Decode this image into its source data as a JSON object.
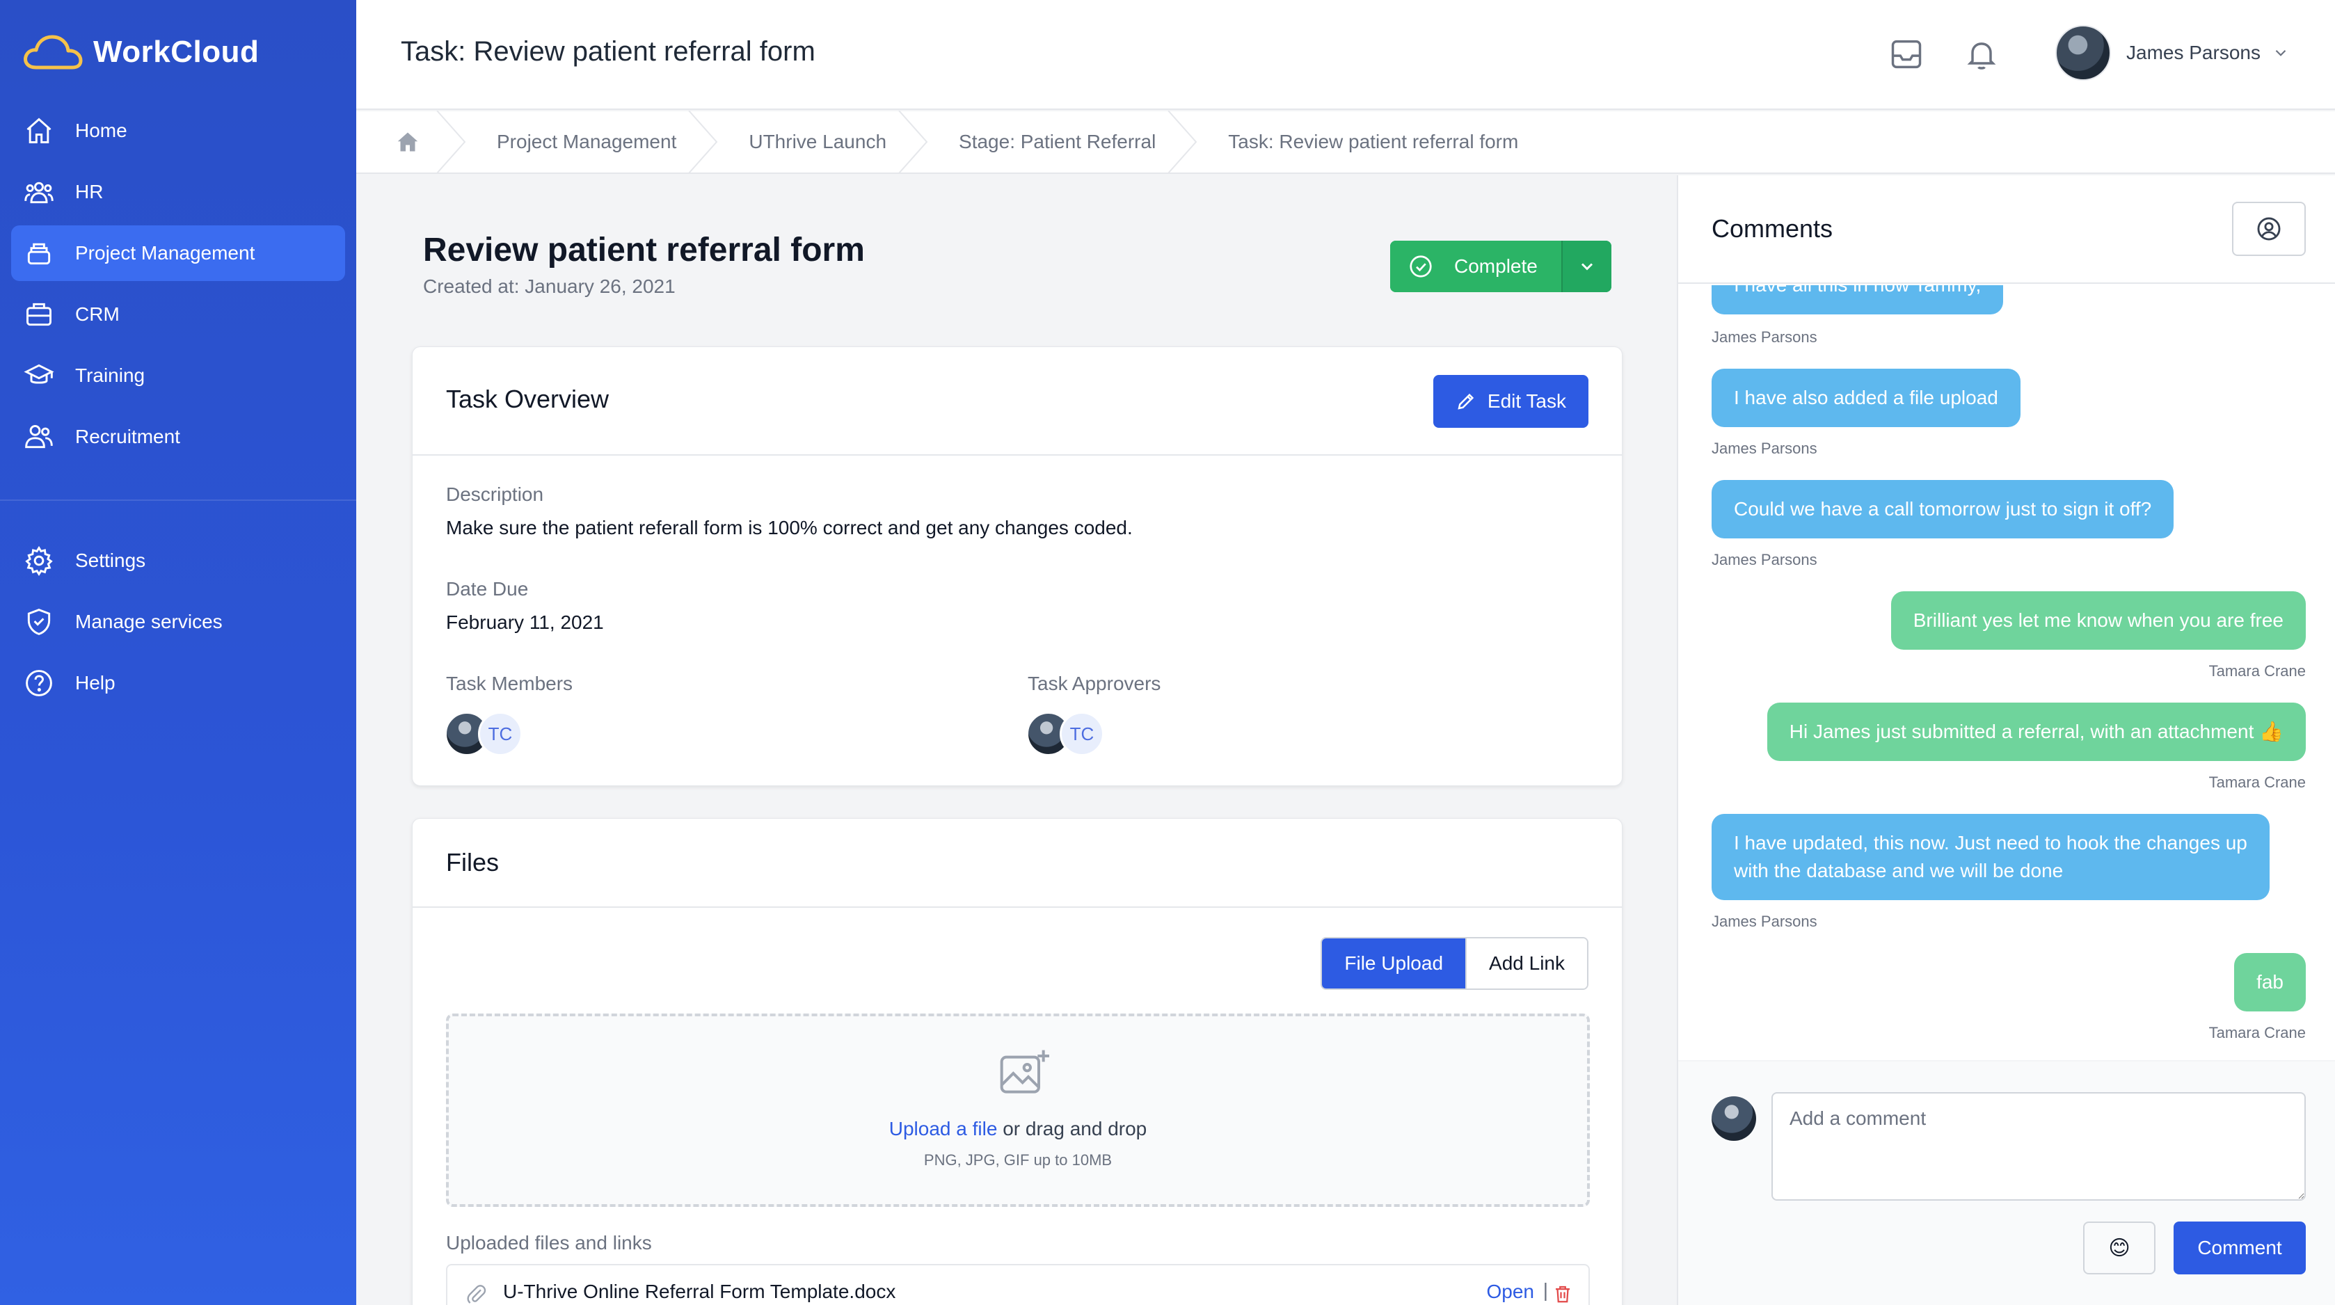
{
  "app": {
    "name": "WorkCloud"
  },
  "sidebar": {
    "items": [
      {
        "label": "Home",
        "icon": "home-icon"
      },
      {
        "label": "HR",
        "icon": "users-icon"
      },
      {
        "label": "Project Management",
        "icon": "stack-icon",
        "active": true
      },
      {
        "label": "CRM",
        "icon": "briefcase-icon"
      },
      {
        "label": "Training",
        "icon": "graduation-cap-icon"
      },
      {
        "label": "Recruitment",
        "icon": "user-group-icon"
      }
    ],
    "secondary": [
      {
        "label": "Settings",
        "icon": "gear-icon"
      },
      {
        "label": "Manage services",
        "icon": "shield-check-icon"
      },
      {
        "label": "Help",
        "icon": "question-circle-icon"
      }
    ]
  },
  "header": {
    "title": "Task: Review patient referral form",
    "user_name": "James Parsons"
  },
  "breadcrumbs": [
    "Project Management",
    "UThrive Launch",
    "Stage: Patient Referral",
    "Task: Review patient referral form"
  ],
  "task": {
    "title": "Review patient referral form",
    "created": "Created at: January 26, 2021",
    "complete_label": "Complete"
  },
  "overview": {
    "title": "Task Overview",
    "edit_label": "Edit Task",
    "description_label": "Description",
    "description": "Make sure the patient referall form is 100% correct and get any changes coded.",
    "due_label": "Date Due",
    "due": "February 11, 2021",
    "members_label": "Task Members",
    "approvers_label": "Task Approvers",
    "member_initials": "TC",
    "approver_initials": "TC"
  },
  "files": {
    "title": "Files",
    "tab_upload": "File Upload",
    "tab_link": "Add Link",
    "upload_link": "Upload a file",
    "upload_rest": " or drag and drop",
    "hint": "PNG, JPG, GIF up to 10MB",
    "uploaded_label": "Uploaded files and links",
    "file_name": "U-Thrive Online Referral Form Template.docx",
    "open_label": "Open",
    "sep": "|"
  },
  "comments": {
    "title": "Comments",
    "messages": [
      {
        "text": "I have all this in now Tammy,",
        "author": "James Parsons",
        "side": "left"
      },
      {
        "text": "I have also added a file upload",
        "author": "James Parsons",
        "side": "left"
      },
      {
        "text": "Could we have a call tomorrow just to sign it off?",
        "author": "James Parsons",
        "side": "left"
      },
      {
        "text": "Brilliant yes let me know when you are free",
        "author": "Tamara Crane",
        "side": "right"
      },
      {
        "text": "Hi James just submitted a referral, with an attachment 👍",
        "author": "Tamara Crane",
        "side": "right"
      },
      {
        "text_line1": "I have updated, this now. Just need to hook the changes up",
        "text_line2": "with the database and we will be done",
        "author": "James Parsons",
        "side": "left"
      },
      {
        "text": "fab",
        "author": "Tamara Crane",
        "side": "right"
      }
    ],
    "placeholder": "Add a comment",
    "emoji": "😊",
    "submit_label": "Comment"
  },
  "colors": {
    "sidebar": "#2c55d6",
    "primary": "#2d5be3",
    "success": "#2bb466",
    "bubble_blue": "#5eb8ee",
    "bubble_green": "#6fd49c"
  }
}
